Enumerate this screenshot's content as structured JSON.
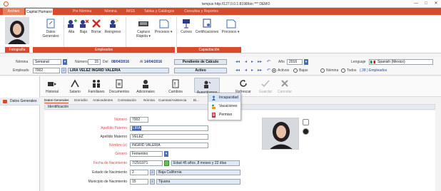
{
  "window": {
    "title": "tempus http://127.0.0.1:8198/bin *** DEMO",
    "min": "—",
    "max": "□",
    "close": "✕"
  },
  "menu_tabs": [
    "Archivo",
    "Capital Humano",
    "Pre Nómina",
    "Nómina",
    "IMSS",
    "Tablas y Catálogos",
    "Consultas y Reportes"
  ],
  "ribbon": {
    "photo_group_label": "Fotografía",
    "employees_group_label": "Empleados",
    "training_group_label": "Capacitación",
    "buttons": {
      "datos_generales": "Datos Generales",
      "alta": "Alta",
      "baja": "Baja",
      "borrar": "Borrar",
      "reingreso": "Reingreso",
      "captura_rapida": "Captura Rápida ▾",
      "procesos": "Procesos ▾",
      "cursos": "Cursos",
      "certificaciones": "Certificaciones",
      "procesos2": "Procesos ▾"
    }
  },
  "filter": {
    "nomina_label": "Nómina",
    "nomina_value": "Semanal",
    "numero_label": "Número",
    "numero_value": "15",
    "del_label": "Del",
    "del_value": "08/04/2016",
    "al_label": "Al",
    "al_value": "14/04/2016",
    "status_value": "Pendiente de Cálculo",
    "anio_label": "Año",
    "anio_value": "2016",
    "lenguaje_label": "Lenguaje",
    "lenguaje_value": "Spanish (Mexico)",
    "empleado_label": "Empleado",
    "empleado_num": "7002",
    "empleado_nombre": "LIRA VELEZ INGRID VALERIA",
    "empleado_status": "Activo",
    "radio_activos": "Activos",
    "radio_bajas": "Bajas",
    "radio_nomina": "Nómina",
    "radio_todos": "Todos",
    "empleados_count": "(.38 ) Empleados"
  },
  "left_nav": {
    "item": "Datos Generales"
  },
  "toolbar": {
    "historial": "Historial",
    "salario": "Salario",
    "familiares": "Familiares",
    "documentos": "Documentos",
    "adicionales": "Adicionales",
    "cambios": "Cambios",
    "ausentismos": "Ausentismos",
    "refrescar": "Refrescar",
    "guardar": "Guardar",
    "cancelar": "Cancelar"
  },
  "sub_tabs": [
    "Datos Generales",
    "Domicilio",
    "Antecedentes",
    "Contratación",
    "Nómina",
    "Cuentas/Asistencia",
    "Bi..."
  ],
  "section": {
    "title": "Identificación"
  },
  "form": {
    "numero_label": "Número",
    "numero": "7002",
    "ap_paterno_label": "Apellido Paterno",
    "ap_paterno": "LIRA",
    "ap_materno_label": "Apellido Materno",
    "ap_materno": "VELEZ",
    "nombre_label": "Nombre (s)",
    "nombre": "INGRID VALERIA",
    "genero_label": "Género",
    "genero": "Femenino",
    "fecha_nac_label": "Fecha de Nacimiento",
    "fecha_nac": "7/25/1971",
    "edad_text": "Edad 45 años ,8 meses y 22 días",
    "estado_nac_label": "Estado de Nacimiento",
    "estado_num": "2",
    "estado_nombre": "Baja California",
    "municipio_nac_label": "Municipio de Nacimiento",
    "municipio_num": "15",
    "municipio_nombre": "Tijuana"
  },
  "dropdown": {
    "items": [
      "Incapacidad",
      "Vacaciones",
      "Permiso"
    ]
  },
  "colors": {
    "accent": "#d74a2b",
    "selection": "#3a63c9",
    "nav": "#4a6ea9"
  }
}
